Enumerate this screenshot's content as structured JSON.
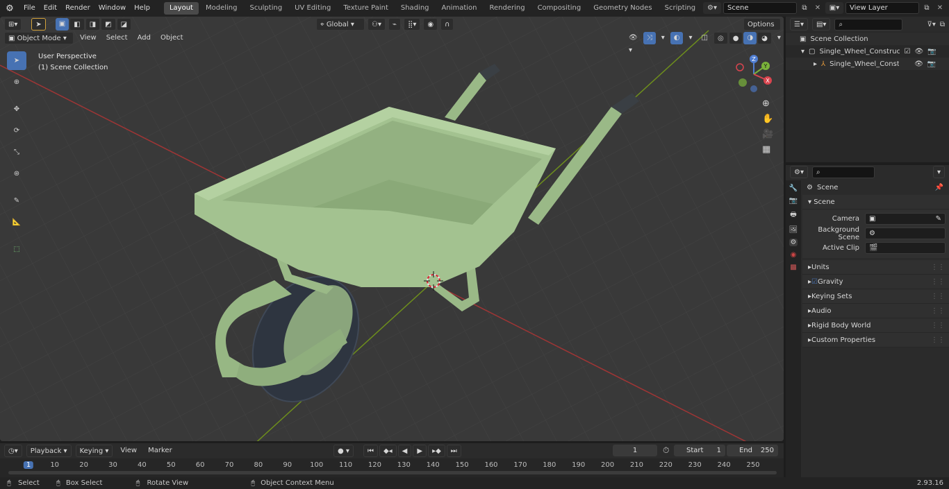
{
  "menu": {
    "file": "File",
    "edit": "Edit",
    "render": "Render",
    "window": "Window",
    "help": "Help"
  },
  "workspaces": [
    "Layout",
    "Modeling",
    "Sculpting",
    "UV Editing",
    "Texture Paint",
    "Shading",
    "Animation",
    "Rendering",
    "Compositing",
    "Geometry Nodes",
    "Scripting"
  ],
  "scene_name": "Scene",
  "view_layer": "View Layer",
  "viewport": {
    "mode": "Object Mode",
    "view": "View",
    "select": "Select",
    "add": "Add",
    "object": "Object",
    "orientation": "Global",
    "options": "Options",
    "overlay_title": "User Perspective",
    "overlay_sub": "(1) Scene Collection"
  },
  "gizmo": {
    "z": "Z",
    "y": "Y",
    "x": "X"
  },
  "outliner": {
    "root": "Scene Collection",
    "items": [
      "Single_Wheel_Construction_T",
      "Single_Wheel_Constructio"
    ]
  },
  "properties": {
    "context": "Scene",
    "panel": "Scene",
    "camera_label": "Camera",
    "bg_scene_label": "Background Scene",
    "active_clip_label": "Active Clip",
    "subpanels": [
      "Units",
      "Gravity",
      "Keying Sets",
      "Audio",
      "Rigid Body World",
      "Custom Properties"
    ]
  },
  "timeline": {
    "playback": "Playback",
    "keying": "Keying",
    "view": "View",
    "marker": "Marker",
    "current_frame": "1",
    "start_label": "Start",
    "start": "1",
    "end_label": "End",
    "end": "250",
    "ticks": [
      "1",
      "10",
      "20",
      "30",
      "40",
      "50",
      "60",
      "70",
      "80",
      "90",
      "100",
      "110",
      "120",
      "130",
      "140",
      "150",
      "160",
      "170",
      "180",
      "190",
      "200",
      "210",
      "220",
      "230",
      "240",
      "250"
    ]
  },
  "status": {
    "select": "Select",
    "box_select": "Box Select",
    "rotate": "Rotate View",
    "context_menu": "Object Context Menu",
    "version": "2.93.16"
  },
  "colors": {
    "accent": "#4772b3",
    "model": "#9cbc89",
    "grid_x": "#b03838",
    "grid_y": "#6e8f1c"
  }
}
